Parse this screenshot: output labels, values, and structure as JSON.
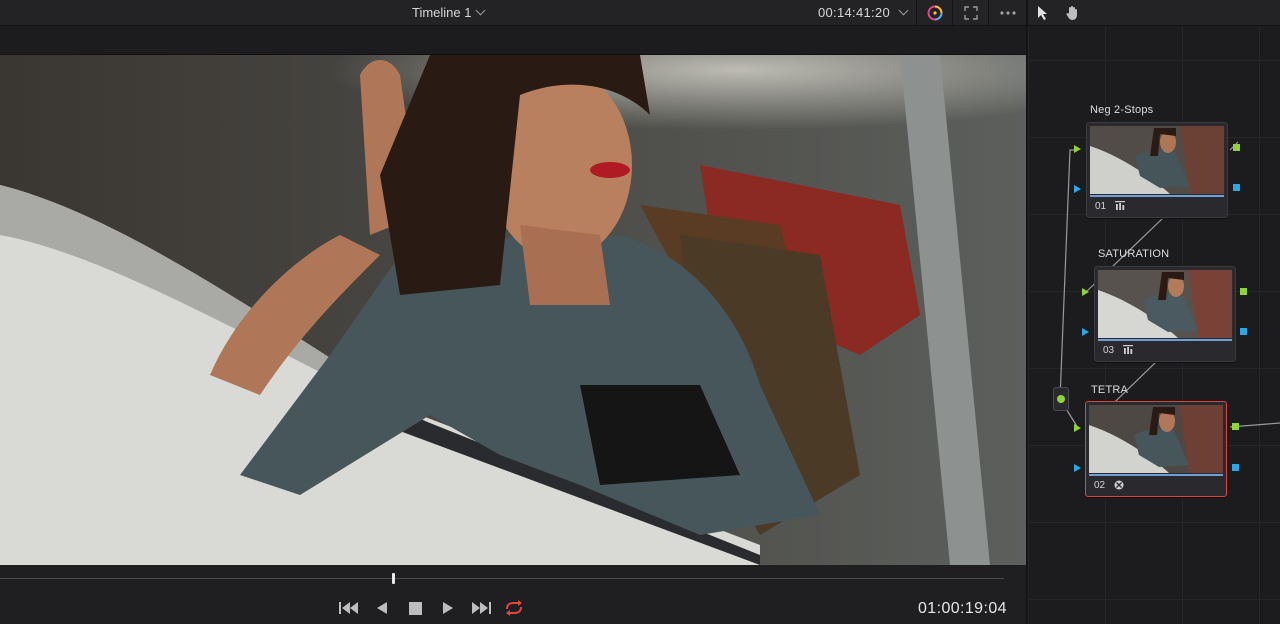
{
  "viewer": {
    "timeline_title": "Timeline 1",
    "timecode_top": "00:14:41:20",
    "timecode_bottom": "01:00:19:04",
    "playhead_fraction": 0.39
  },
  "node_graph": {
    "nodes": [
      {
        "label": "Neg 2-Stops",
        "number": "01",
        "icon": "bars-icon",
        "selected": false
      },
      {
        "label": "SATURATION",
        "number": "03",
        "icon": "bars-icon",
        "selected": false
      },
      {
        "label": "TETRA",
        "number": "02",
        "icon": "ofx-icon",
        "selected": true
      }
    ]
  },
  "colors": {
    "accent_red": "#d9463a",
    "port_green": "#8fd33a",
    "port_blue": "#2ba8e8",
    "panel_bg": "#1c1c1f"
  }
}
